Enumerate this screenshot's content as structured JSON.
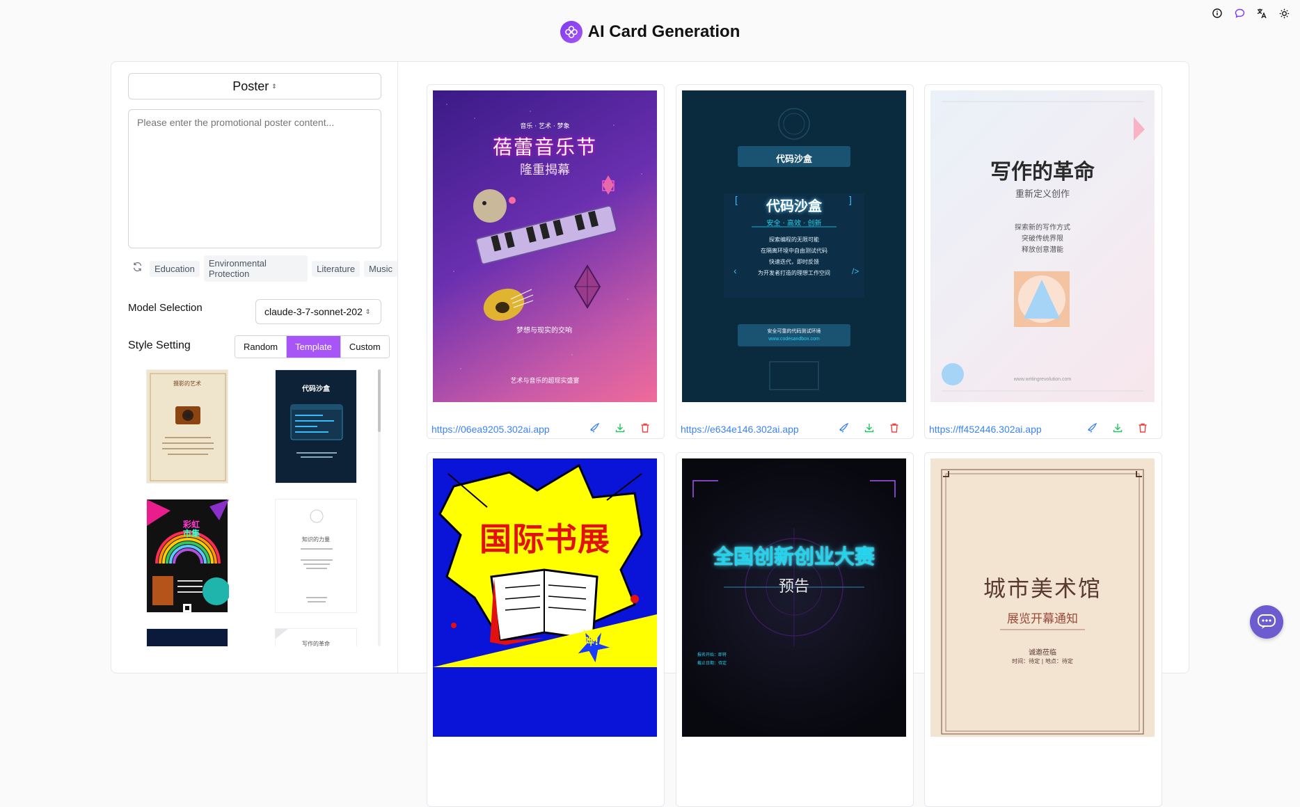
{
  "header": {
    "title": "AI Card Generation",
    "logo_icon": "flower-logo-icon"
  },
  "top_icons": [
    "info-icon",
    "chat-bubble-icon",
    "translate-icon",
    "sun-icon"
  ],
  "left": {
    "type_select": "Poster",
    "textarea_placeholder": "Please enter the promotional poster content...",
    "tags": [
      "Education",
      "Environmental Protection",
      "Literature",
      "Music"
    ],
    "model_label": "Model Selection",
    "model_value": "claude-3-7-sonnet-202",
    "style_label": "Style Setting",
    "style_options": [
      "Random",
      "Template",
      "Custom"
    ],
    "thumb1": {
      "title": "摄影的艺术"
    },
    "thumb2": {
      "title": "代码沙盒"
    },
    "thumb3": {
      "title": "彩虹",
      "title2": "市集"
    },
    "thumb4": {
      "title": "知识的力量"
    },
    "thumb6": {
      "title": "写作的革命"
    }
  },
  "cards": [
    {
      "url": "https://06ea9205.302ai.app",
      "eyebrow": "音乐 · 艺术 · 梦象",
      "title": "蓓蕾音乐节",
      "subtitle": "隆重揭幕",
      "mid": "梦想与现实的交响",
      "footer": "艺术与音乐的超现实盛宴"
    },
    {
      "url": "https://e634e146.302ai.app",
      "title": "代码沙盒",
      "big": "代码沙盒",
      "tagline": "安全 · 高效 · 创新",
      "lines": [
        "探索编程的无限可能",
        "在隔离环境中自由测试代码",
        "快速迭代，即时反馈",
        "为开发者打造的理想工作空间"
      ],
      "foot1": "安全可靠的代码测试环境",
      "foot2": "www.codesandbox.com"
    },
    {
      "url": "https://ff452446.302ai.app",
      "title": "写作的革命",
      "subtitle": "重新定义创作",
      "lines": [
        "探索新的写作方式",
        "突破传统界限",
        "释放创意潜能"
      ],
      "site": "www.writingrevolution.com"
    },
    {
      "title": "国际书展",
      "badge": "哗!"
    },
    {
      "title": "全国创新创业大赛",
      "subtitle": "预告",
      "small1": "报名开始：即将",
      "small2": "截止日期：待定"
    },
    {
      "title": "城市美术馆",
      "subtitle": "展览开幕通知",
      "line1": "诚邀莅临",
      "line2": "时间：待定 | 地点：待定"
    }
  ],
  "colors": {
    "accent": "#a855f7",
    "link": "#3b82f6",
    "delete": "#ef4444",
    "download": "#22c55e"
  }
}
